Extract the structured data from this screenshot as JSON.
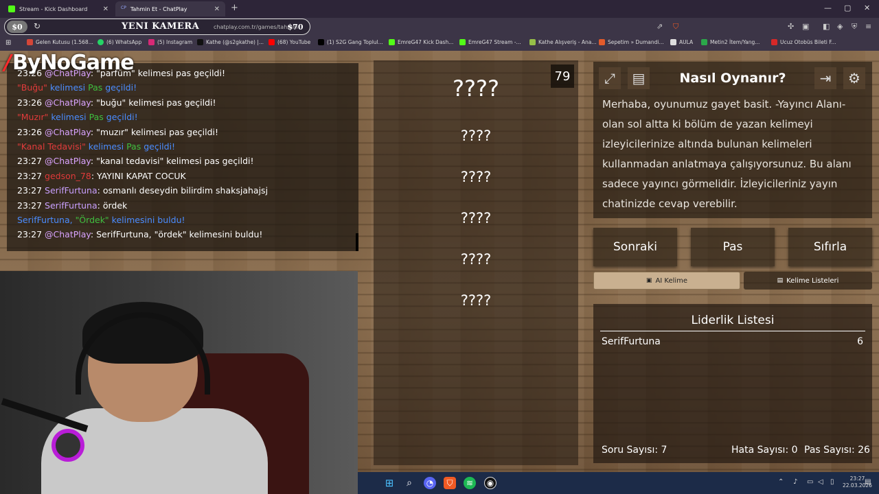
{
  "browser": {
    "tabs": [
      {
        "label": "Stream - Kick Dashboard"
      },
      {
        "label": "Tahmin Et - ChatPlay"
      }
    ],
    "overlay": {
      "left_amount": "$0",
      "title": "YENI KAMERA",
      "right_amount": "$70"
    },
    "url": "chatplay.com.tr/games/tahmin",
    "bookmarks": [
      {
        "label": "Gelen Kutusu (1.568...",
        "color": "#d44638"
      },
      {
        "label": "(6) WhatsApp",
        "color": "#25d366"
      },
      {
        "label": "(5) Instagram",
        "color": "#d62976"
      },
      {
        "label": "Kathe (@s2gkathe) |...",
        "color": "#111111"
      },
      {
        "label": "(68) YouTube",
        "color": "#ff0000"
      },
      {
        "label": "(1) S2G Gang Toplul...",
        "color": "#000000"
      },
      {
        "label": "EmreG47 Kick Dash...",
        "color": "#53fc18"
      },
      {
        "label": "EmreG47 Stream -...",
        "color": "#53fc18"
      },
      {
        "label": "Kathe Alışveriş - Ana...",
        "color": "#96bf48"
      },
      {
        "label": "Sepetim » Dumandi...",
        "color": "#e35b2b"
      },
      {
        "label": "AULA",
        "color": "#dddddd"
      },
      {
        "label": "Metin2 İtem/Yang...",
        "color": "#2ba84a"
      },
      {
        "label": "Ucuz Otobüs Bileti F...",
        "color": "#d62828"
      }
    ]
  },
  "stream": {
    "logo": "ByNoGame",
    "chat": [
      {
        "time": "23:26",
        "user": "@ChatPlay",
        "text": ": \"parfüm\" kelimesi pas geçildi!"
      },
      {
        "sys": [
          {
            "t": "\"Buğu\"",
            "c": "red"
          },
          {
            "t": " kelimesi ",
            "c": "blue"
          },
          {
            "t": "Pas",
            "c": "green"
          },
          {
            "t": " geçildi!",
            "c": "blue"
          }
        ]
      },
      {
        "time": "23:26",
        "user": "@ChatPlay",
        "text": ": \"buğu\" kelimesi pas geçildi!"
      },
      {
        "sys": [
          {
            "t": "\"Muzır\"",
            "c": "red"
          },
          {
            "t": " kelimesi ",
            "c": "blue"
          },
          {
            "t": "Pas",
            "c": "green"
          },
          {
            "t": " geçildi!",
            "c": "blue"
          }
        ]
      },
      {
        "time": "23:26",
        "user": "@ChatPlay",
        "text": ": \"muzır\" kelimesi pas geçildi!"
      },
      {
        "sys": [
          {
            "t": "\"Kanal Tedavisi\"",
            "c": "red"
          },
          {
            "t": " kelimesi ",
            "c": "blue"
          },
          {
            "t": "Pas",
            "c": "green"
          },
          {
            "t": " geçildi!",
            "c": "blue"
          }
        ]
      },
      {
        "time": "23:27",
        "user": "@ChatPlay",
        "text": ": \"kanal tedavisi\" kelimesi pas geçildi!"
      },
      {
        "time": "23:27",
        "user": "gedson_78",
        "user_color": "red",
        "text": ": YAYINI KAPAT COCUK"
      },
      {
        "time": "23:27",
        "user": "SerifFurtuna",
        "user_color": "purple",
        "text": ": osmanlı deseydin bilirdim shaksjahajsj"
      },
      {
        "time": "23:27",
        "user": "SerifFurtuna",
        "user_color": "purple",
        "text": ": ördek"
      },
      {
        "sys": [
          {
            "t": "SerifFurtuna, ",
            "c": "blue"
          },
          {
            "t": "\"Ördek\"",
            "c": "green"
          },
          {
            "t": " kelimesini buldu!",
            "c": "blue"
          }
        ]
      },
      {
        "time": "23:27",
        "user": "@ChatPlay",
        "text": ": SerifFurtuna, \"ördek\" kelimesini buldu!"
      }
    ]
  },
  "game": {
    "counter": "79",
    "words": [
      "????",
      "????",
      "????",
      "????",
      "????",
      "????"
    ],
    "how_title": "Nasıl Oynanır?",
    "how_text": "Merhaba, oyunumuz gayet basit. -Yayıncı Alanı- olan sol altta ki bölüm de yazan kelimeyi izleyicilerinize altında bulunan kelimeleri kullanmadan anlatmaya çalışıyorsunuz. Bu alanı sadece yayıncı görmelidir. İzleyicileriniz yayın chatinizde cevap verebilir.",
    "buttons": {
      "next": "Sonraki",
      "pass": "Pas",
      "reset": "Sıfırla"
    },
    "tabs": {
      "ai": "AI Kelime",
      "lists": "Kelime Listeleri"
    },
    "leaderboard": {
      "title": "Liderlik Listesi",
      "rows": [
        {
          "name": "SerifFurtuna",
          "score": "6"
        }
      ]
    },
    "stats": {
      "questions": "Soru Sayısı: 7",
      "errors": "Hata Sayısı: 0",
      "passes": "Pas Sayısı: 26"
    }
  },
  "taskbar": {
    "time": "23:27",
    "date": "22.03.2026"
  }
}
